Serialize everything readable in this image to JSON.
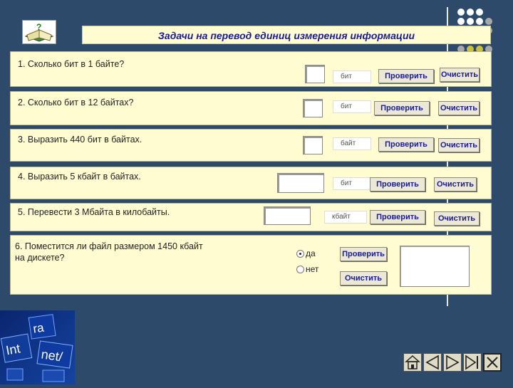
{
  "title": "Задачи на перевод единиц измерения информации",
  "colors": {
    "background": "#2d4a6b",
    "panel": "#fffcd2",
    "title_text": "#1a1a9a"
  },
  "questions": [
    {
      "text": "1. Сколько бит в 1 байте?",
      "unit": "бит",
      "check": "Проверить",
      "clear": "Очистить"
    },
    {
      "text": "2. Сколько бит в 12 байтах?",
      "unit": "бит",
      "check": "Проверить",
      "clear": "Очистить"
    },
    {
      "text": "3. Выразить 440 бит в байтах.",
      "unit": "байт",
      "check": "Проверить",
      "clear": "Очистить"
    },
    {
      "text": "4. Выразить 5 кбайт в байтах.",
      "unit": "бит",
      "check": "Проверить",
      "clear": "Очистить"
    },
    {
      "text": "5. Перевести 3 Мбайта в килобайты.",
      "unit": "кбайт",
      "check": "Проверить",
      "clear": "Очистить"
    }
  ],
  "q6": {
    "line1": "6. Поместится ли файл размером 1450 кбайт",
    "line2": "на дискете?",
    "yes": "да",
    "no": "нет",
    "check": "Проверить",
    "clear": "Очистить"
  },
  "decor_text": {
    "a": "ra",
    "b": "Int",
    "c": "net/"
  },
  "icons": [
    "book-logo-icon",
    "home-icon",
    "prev-icon",
    "next-icon",
    "last-slide-icon",
    "close-icon"
  ]
}
